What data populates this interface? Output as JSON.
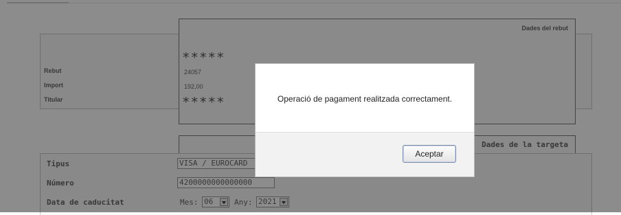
{
  "receipt": {
    "section_title": "Dades del rebut",
    "labels": [
      "Rebut",
      "Import",
      "Titular"
    ],
    "masked_top": "*****",
    "rebut_value": "24057",
    "import_value": "192,00",
    "masked_holder": "*****"
  },
  "card": {
    "section_title": "Dades de la targeta",
    "type_label": "Tipus",
    "type_value": "VISA / EUROCARD",
    "number_label": "Número",
    "number_value": "4200000000000000",
    "expiry_label": "Data de caducitat",
    "month_label": "Mes:",
    "month_value": "06",
    "year_label": "Any:",
    "year_value": "2021"
  },
  "dialog": {
    "message": "Operació de pagament realitzada correctament.",
    "ok_label": "Aceptar"
  },
  "colors": {
    "overlay": "#000000",
    "button_border": "#7f8da8"
  },
  "icons": {
    "select_arrow": "chevron-down-icon"
  }
}
